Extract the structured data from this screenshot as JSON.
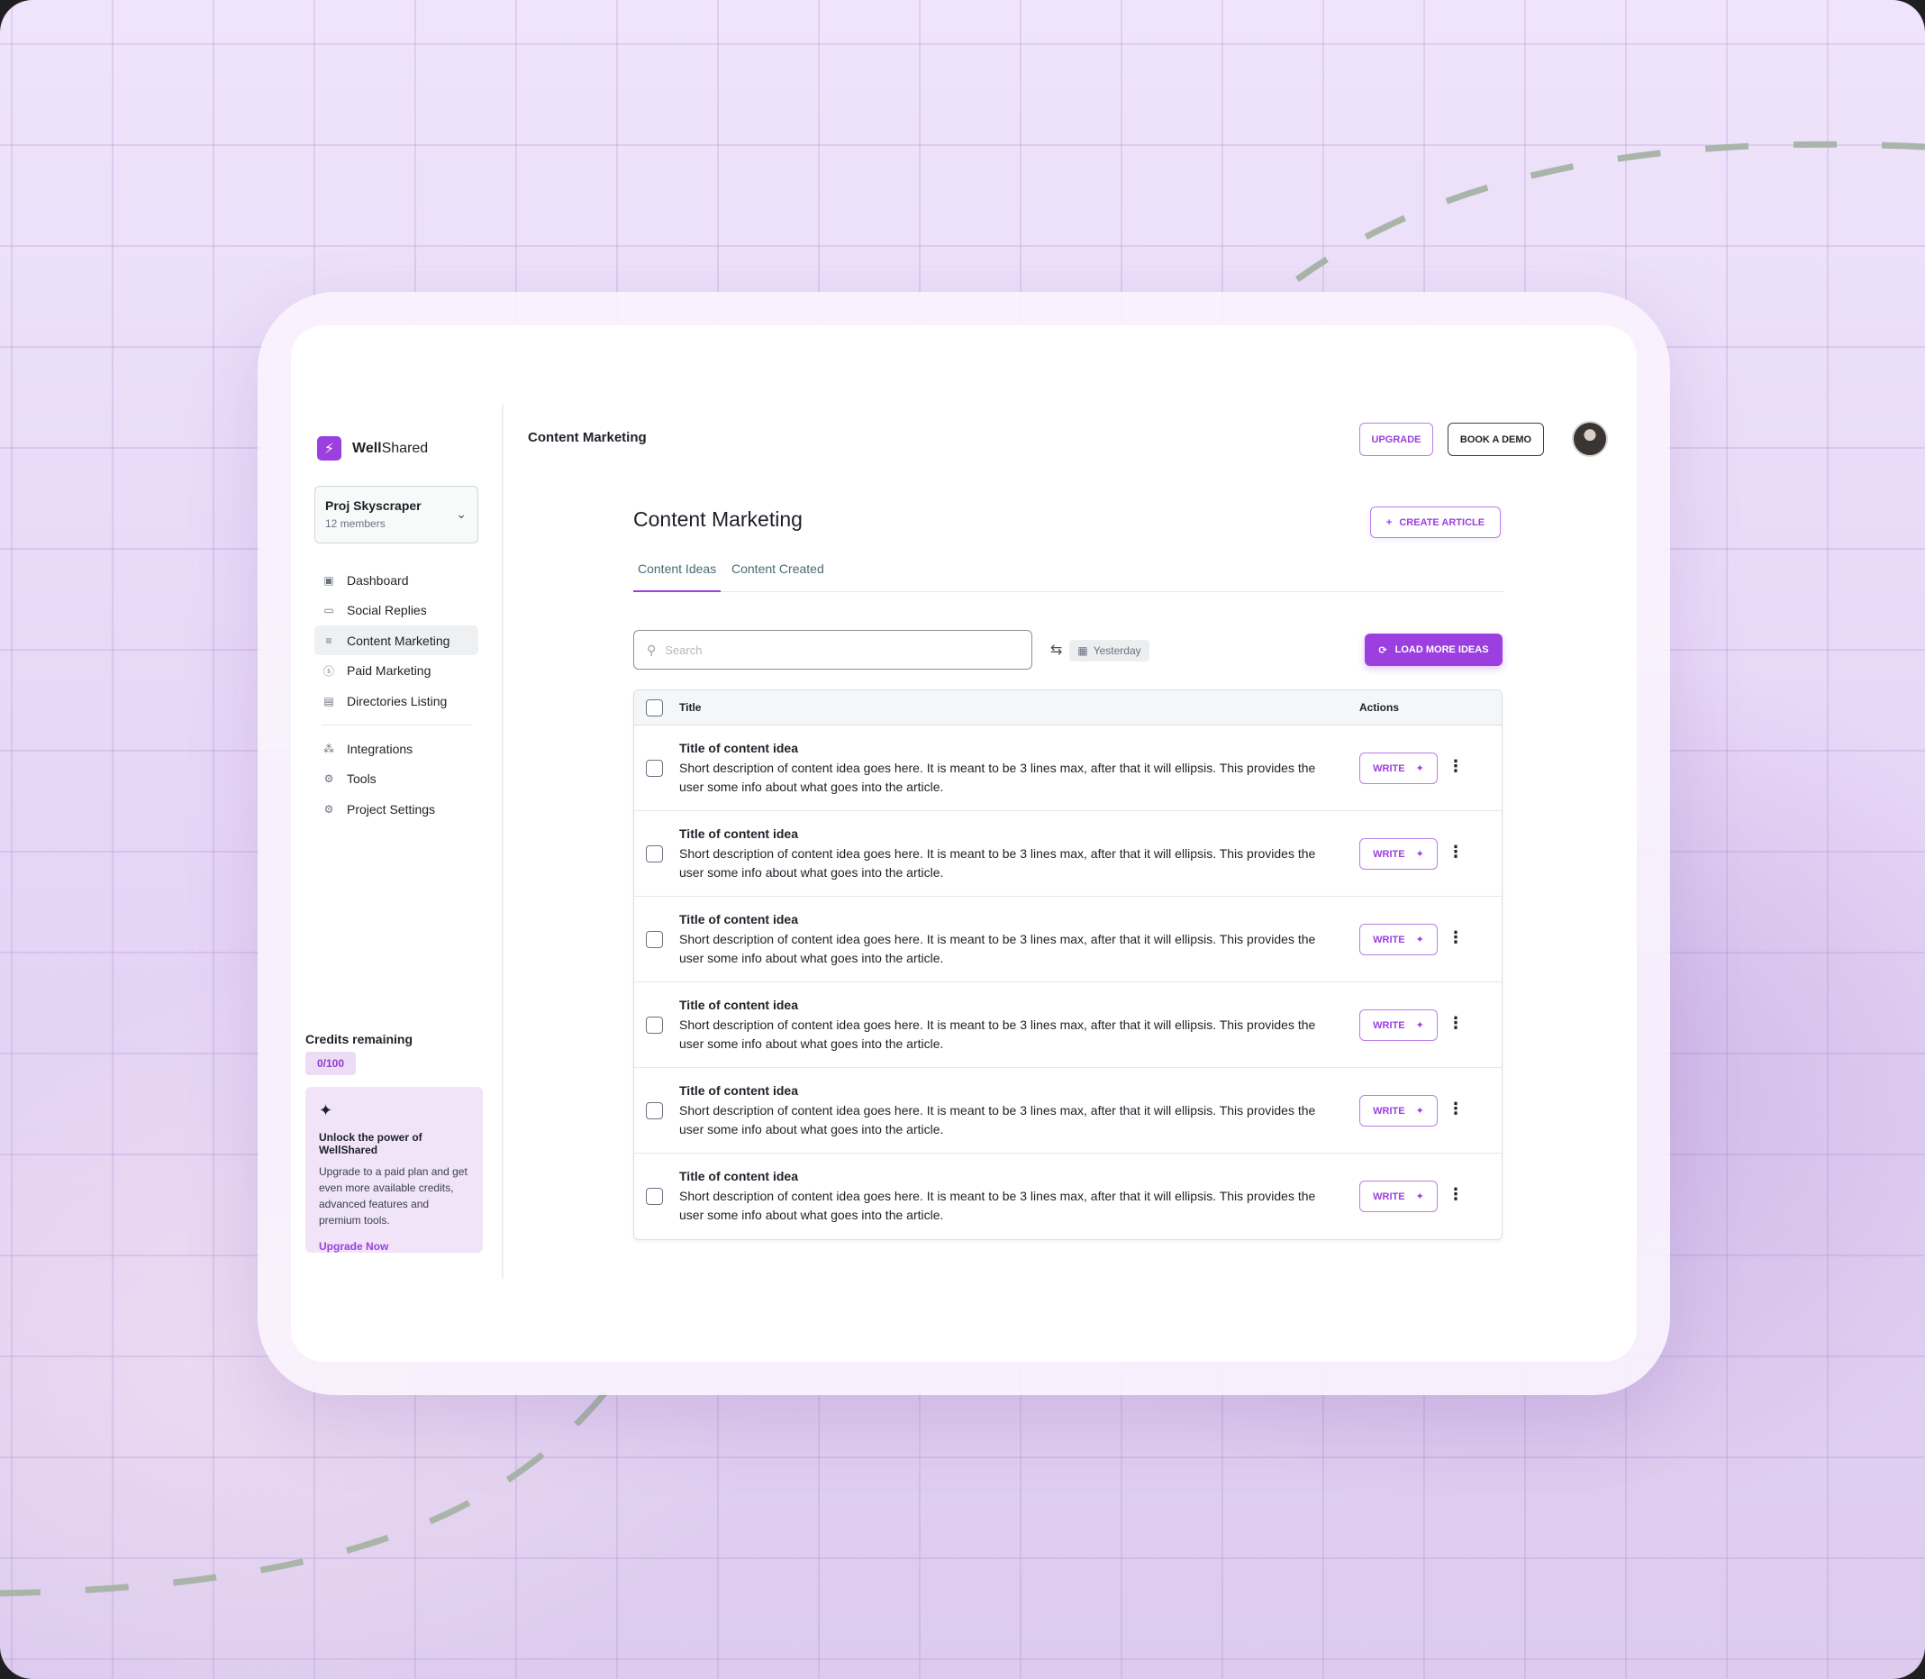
{
  "brand": {
    "name_bold": "Well",
    "name_rest": "Shared",
    "icon": "bolt-icon"
  },
  "project": {
    "name": "Proj Skyscraper",
    "members": "12 members"
  },
  "sidebar": {
    "items": [
      {
        "label": "Dashboard",
        "icon": "dashboard-icon"
      },
      {
        "label": "Social Replies",
        "icon": "chat-icon"
      },
      {
        "label": "Content Marketing",
        "icon": "lines-icon",
        "active": true
      },
      {
        "label": "Paid Marketing",
        "icon": "dollar-icon"
      },
      {
        "label": "Directories Listing",
        "icon": "directory-icon"
      }
    ],
    "secondary": [
      {
        "label": "Integrations",
        "icon": "apps-icon"
      },
      {
        "label": "Tools",
        "icon": "gear-icon"
      },
      {
        "label": "Project Settings",
        "icon": "settings-icon"
      }
    ],
    "credits_label": "Credits remaining",
    "credits_value": "0/100",
    "promo": {
      "title": "Unlock the power of WellShared",
      "body": "Upgrade to a paid plan and get even more available credits, advanced features and premium tools.",
      "link": "Upgrade Now"
    }
  },
  "header": {
    "title": "Content Marketing",
    "upgrade_label": "UPGRADE",
    "demo_label": "BOOK A DEMO"
  },
  "main": {
    "title": "Content Marketing",
    "create_label": "CREATE ARTICLE",
    "tabs": [
      {
        "label": "Content Ideas",
        "active": true
      },
      {
        "label": "Content Created"
      }
    ],
    "search_placeholder": "Search",
    "date_filter": "Yesterday",
    "load_more_label": "LOAD MORE IDEAS",
    "table": {
      "col_title": "Title",
      "col_actions": "Actions",
      "write_label": "WRITE",
      "rows": [
        {
          "title": "Title of content idea",
          "desc": "Short description of content idea goes here. It is meant to be 3 lines max, after that it will ellipsis. This provides the user some info about what goes into the article."
        },
        {
          "title": "Title of content idea",
          "desc": "Short description of content idea goes here. It is meant to be 3 lines max, after that it will ellipsis. This provides the user some info about what goes into the article."
        },
        {
          "title": "Title of content idea",
          "desc": "Short description of content idea goes here. It is meant to be 3 lines max, after that it will ellipsis. This provides the user some info about what goes into the article."
        },
        {
          "title": "Title of content idea",
          "desc": "Short description of content idea goes here. It is meant to be 3 lines max, after that it will ellipsis. This provides the user some info about what goes into the article."
        },
        {
          "title": "Title of content idea",
          "desc": "Short description of content idea goes here. It is meant to be 3 lines max, after that it will ellipsis. This provides the user some info about what goes into the article."
        },
        {
          "title": "Title of content idea",
          "desc": "Short description of content idea goes here. It is meant to be 3 lines max, after that it will ellipsis. This provides the user some info about what goes into the article."
        }
      ]
    }
  },
  "colors": {
    "accent": "#9b3fe0",
    "background": "#e8d9f7",
    "dash": "#a8b5a8"
  }
}
